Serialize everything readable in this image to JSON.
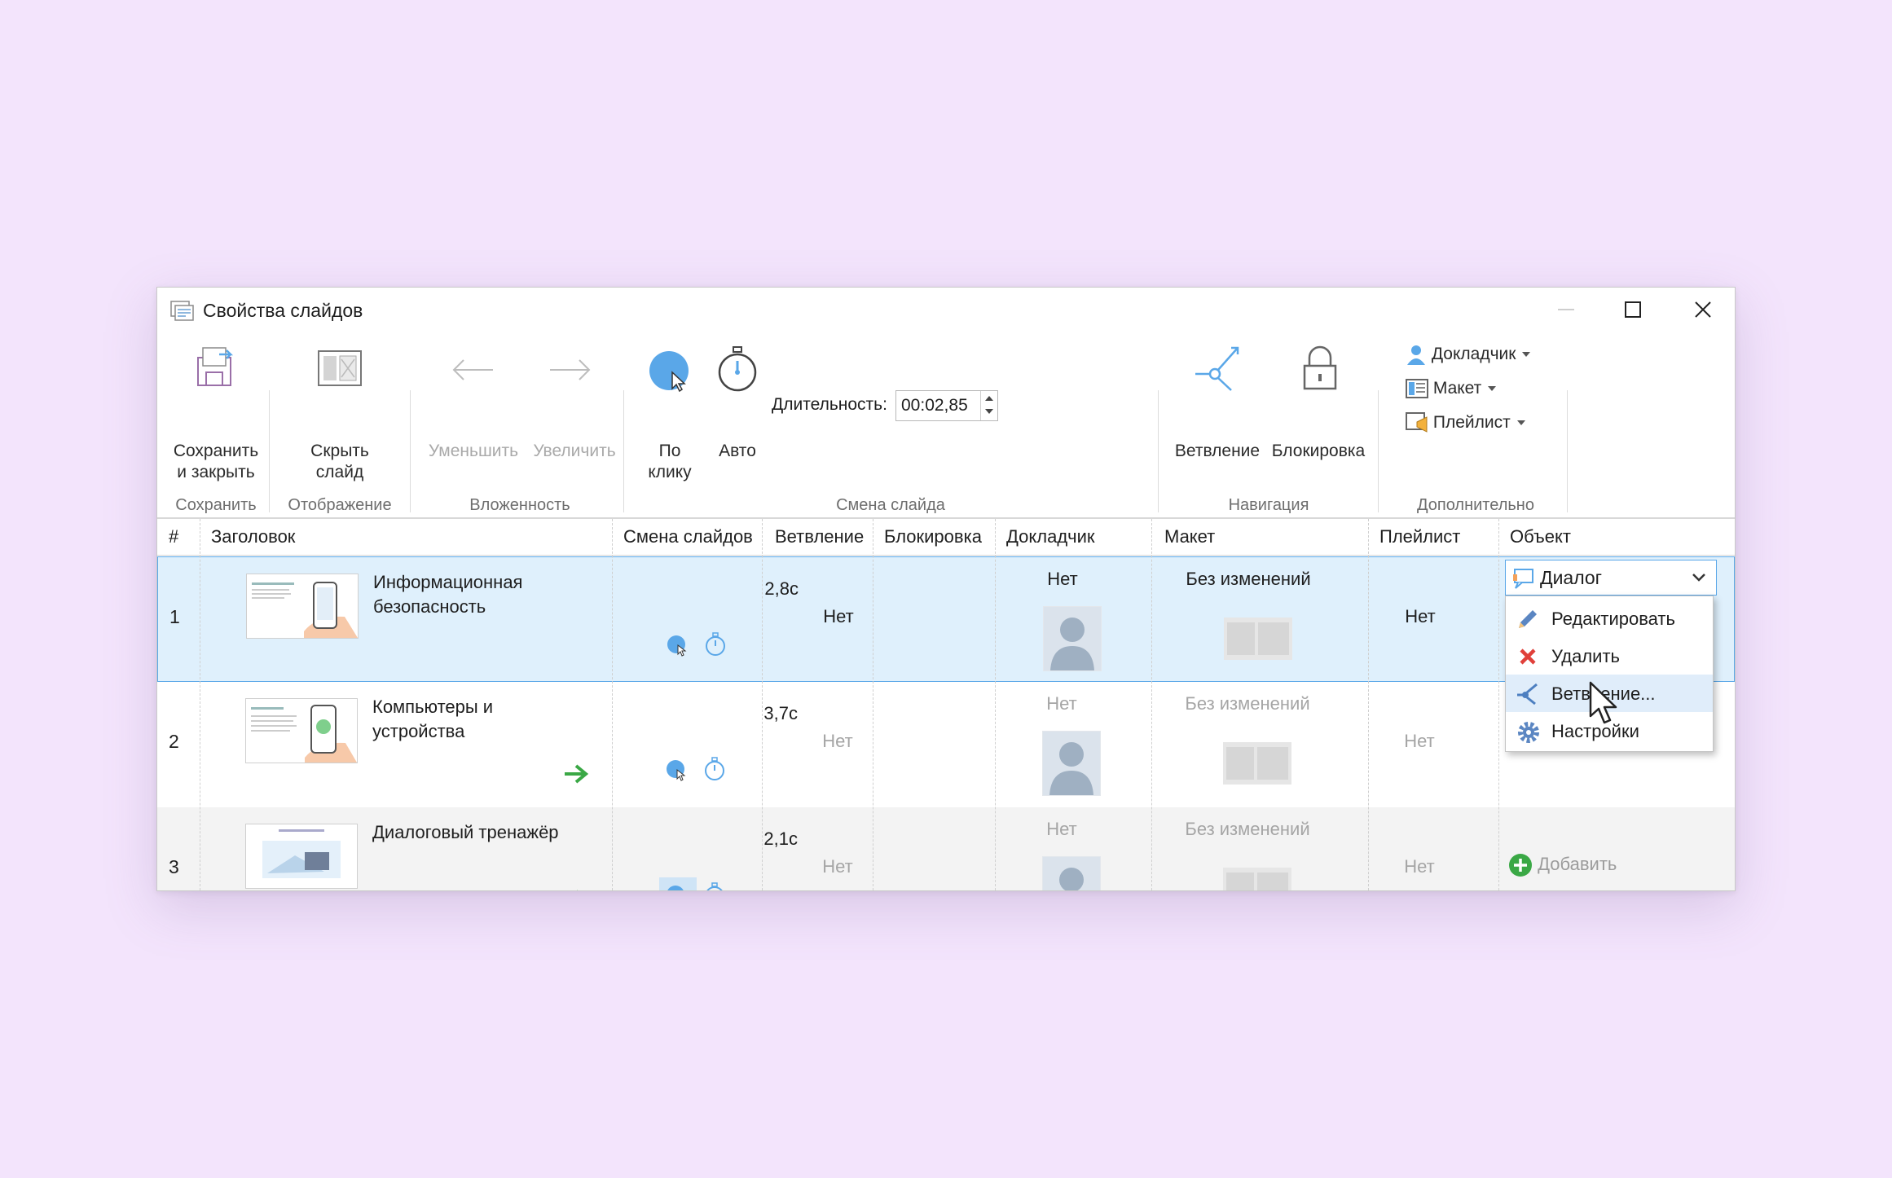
{
  "window": {
    "title": "Свойства слайдов"
  },
  "ribbon": {
    "save": {
      "line1": "Сохранить",
      "line2": "и закрыть",
      "group": "Сохранить"
    },
    "hide": {
      "line1": "Скрыть",
      "line2": "слайд",
      "group": "Отображение"
    },
    "nesting": {
      "decrease": "Уменьшить",
      "increase": "Увеличить",
      "group": "Вложенность"
    },
    "transition": {
      "on_click_line1": "По",
      "on_click_line2": "клику",
      "auto": "Авто",
      "duration_label": "Длительность:",
      "duration_value": "00:02,85",
      "group": "Смена слайда"
    },
    "navigation": {
      "branching": "Ветвление",
      "lock": "Блокировка",
      "group": "Навигация"
    },
    "extra": {
      "presenter": "Докладчик",
      "layout": "Макет",
      "playlist": "Плейлист",
      "group": "Дополнительно"
    }
  },
  "table": {
    "columns": [
      "#",
      "Заголовок",
      "Смена слайдов",
      "Ветвление",
      "Блокировка",
      "Докладчик",
      "Макет",
      "Плейлист",
      "Объект"
    ],
    "rows": [
      {
        "num": "1",
        "title_line1": "Информационная",
        "title_line2": "безопасность",
        "time": "2,8с",
        "branching": "Нет",
        "presenter": "Нет",
        "layout": "Без изменений",
        "playlist": "Нет"
      },
      {
        "num": "2",
        "title_line1": "Компьютеры и",
        "title_line2": "устройства",
        "time": "3,7с",
        "branching": "Нет",
        "presenter": "Нет",
        "layout": "Без изменений",
        "playlist": "Нет"
      },
      {
        "num": "3",
        "title_line1": "Диалоговый тренажёр",
        "title_line2": "",
        "time": "2,1с",
        "branching": "Нет",
        "presenter": "Нет",
        "layout": "Без изменений",
        "playlist": "Нет"
      }
    ],
    "object_combo": "Диалог",
    "object_menu": [
      "Редактировать",
      "Удалить",
      "Ветвление...",
      "Настройки"
    ],
    "add_label": "Добавить"
  },
  "colors": {
    "accent": "#5aa7e8",
    "selection": "#dff0fc",
    "background": "#f3e4fc",
    "green": "#3aa845",
    "red": "#e0403a"
  }
}
